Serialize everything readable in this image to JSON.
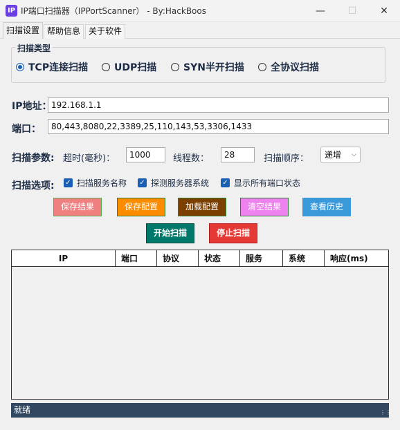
{
  "window": {
    "icon_text": "IP",
    "title": "IP端口扫描器（IPPortScanner） - By:HackBoos"
  },
  "tabs": [
    {
      "label": "扫描设置"
    },
    {
      "label": "帮助信息"
    },
    {
      "label": "关于软件"
    }
  ],
  "scan_type": {
    "group_label": "扫描类型",
    "options": [
      {
        "label": "TCP连接扫描",
        "checked": true
      },
      {
        "label": "UDP扫描",
        "checked": false
      },
      {
        "label": "SYN半开扫描",
        "checked": false
      },
      {
        "label": "全协议扫描",
        "checked": false
      }
    ]
  },
  "target": {
    "ip_label": "IP地址：",
    "ip_value": "192.168.1.1",
    "port_label": "端口：",
    "port_value": "80,443,8080,22,3389,25,110,143,53,3306,1433"
  },
  "params": {
    "label": "扫描参数:",
    "timeout_label": "超时(毫秒)：",
    "timeout_value": "1000",
    "threads_label": "线程数：",
    "threads_value": "28",
    "order_label": "扫描顺序：",
    "order_value": "递增"
  },
  "options": {
    "label": "扫描选项:",
    "items": [
      {
        "label": "扫描服务名称",
        "checked": true
      },
      {
        "label": "探测服务器系统",
        "checked": true
      },
      {
        "label": "显示所有端口状态",
        "checked": true
      }
    ]
  },
  "buttons": {
    "save_results": "保存结果",
    "save_config": "保存配置",
    "load_config": "加载配置",
    "clear_results": "清空结果",
    "view_history": "查看历史",
    "start_scan": "开始扫描",
    "stop_scan": "停止扫描"
  },
  "button_colors": {
    "save_results": "#f08080",
    "save_config": "#fb8c00",
    "load_config": "#7b3f00",
    "clear_results": "#ee82ee",
    "view_history": "#3a9ad9",
    "start_scan": "#00796b",
    "stop_scan": "#e53935"
  },
  "table": {
    "columns": [
      "IP",
      "端口",
      "协议",
      "状态",
      "服务",
      "系统",
      "响应(ms)"
    ]
  },
  "status": {
    "text": "就绪"
  },
  "icons": [
    "minimize-icon",
    "maximize-icon",
    "close-icon",
    "radio-icon",
    "checkbox-icon",
    "chevron-down-icon",
    "resize-grip-icon"
  ]
}
